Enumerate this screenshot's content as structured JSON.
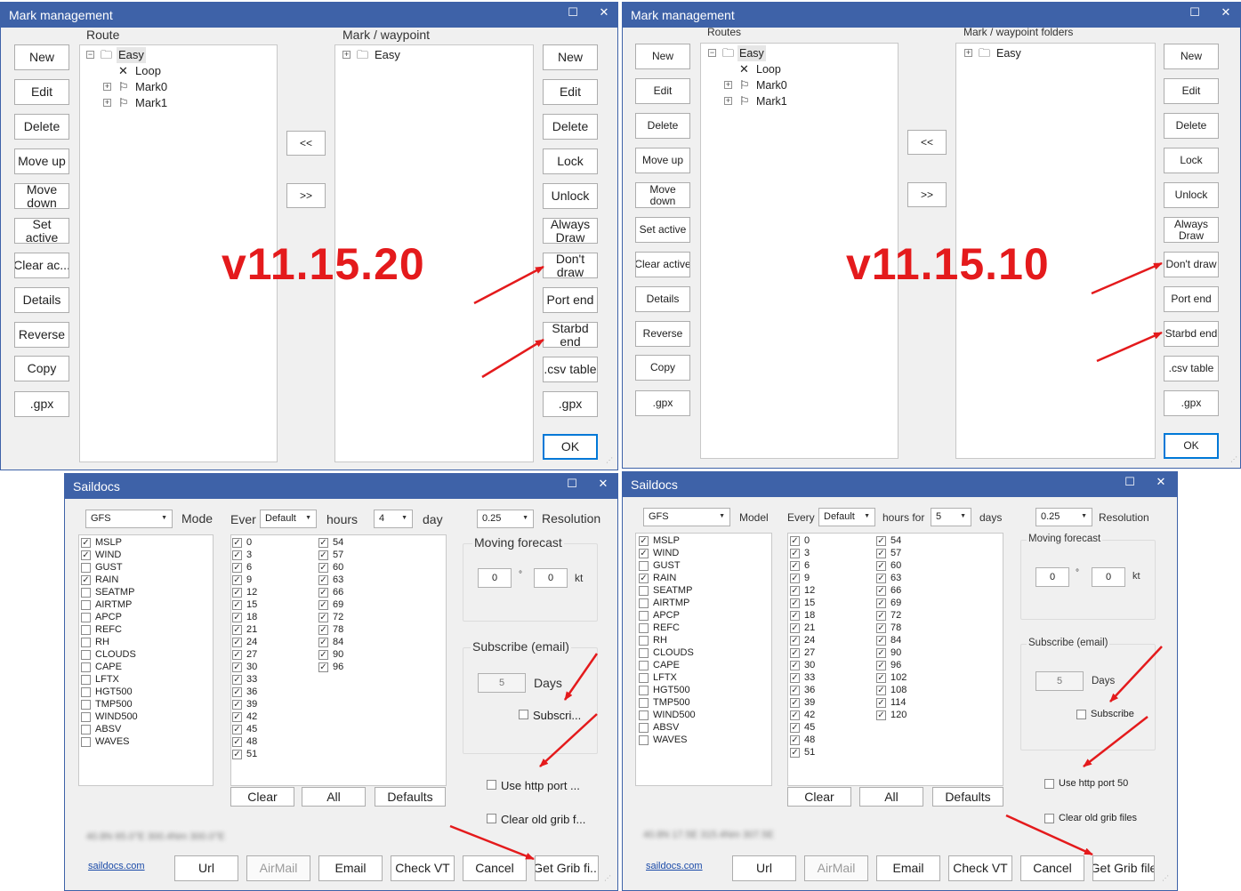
{
  "v1": {
    "title": "Mark management",
    "route_label": "Route",
    "mark_label": "Mark / waypoint",
    "left_buttons": [
      "New",
      "Edit",
      "Delete",
      "Move up",
      "Move down",
      "Set active",
      "Clear ac...",
      "Details",
      "Reverse",
      "Copy",
      ".gpx"
    ],
    "right_buttons": [
      "New",
      "Edit",
      "Delete",
      "Lock",
      "Unlock",
      "Always Draw",
      "Don't draw",
      "Port end",
      "Starbd end",
      ".csv table",
      ".gpx",
      "OK"
    ],
    "move_left": "<<",
    "move_right": ">>",
    "route_tree": [
      "Easy",
      "Loop",
      "Mark0",
      "Mark1"
    ],
    "mark_tree": [
      "Easy"
    ],
    "version": "v11.15.20"
  },
  "v2": {
    "title": "Mark management",
    "route_label": "Routes",
    "mark_label": "Mark / waypoint folders",
    "left_buttons": [
      "New",
      "Edit",
      "Delete",
      "Move up",
      "Move down",
      "Set active",
      "Clear active",
      "Details",
      "Reverse",
      "Copy",
      ".gpx"
    ],
    "right_buttons": [
      "New",
      "Edit",
      "Delete",
      "Lock",
      "Unlock",
      "Always Draw",
      "Don't draw",
      "Port end",
      "Starbd end",
      ".csv table",
      ".gpx",
      "OK"
    ],
    "move_left": "<<",
    "move_right": ">>",
    "route_tree": [
      "Easy",
      "Loop",
      "Mark0",
      "Mark1"
    ],
    "mark_tree": [
      "Easy"
    ],
    "version": "v11.15.10"
  },
  "s1": {
    "title": "Saildocs",
    "model_value": "GFS",
    "model_label": "Mode",
    "every_label": "Ever",
    "every_value": "Default",
    "hours_label": "hours",
    "days_value": "4",
    "days_label": "day",
    "res_value": "0.25",
    "res_label": "Resolution",
    "params": [
      {
        "n": "MSLP",
        "c": true
      },
      {
        "n": "WIND",
        "c": true
      },
      {
        "n": "GUST",
        "c": false
      },
      {
        "n": "RAIN",
        "c": true
      },
      {
        "n": "SEATMP",
        "c": false
      },
      {
        "n": "AIRTMP",
        "c": false
      },
      {
        "n": "APCP",
        "c": false
      },
      {
        "n": "REFC",
        "c": false
      },
      {
        "n": "RH",
        "c": false
      },
      {
        "n": "CLOUDS",
        "c": false
      },
      {
        "n": "CAPE",
        "c": false
      },
      {
        "n": "LFTX",
        "c": false
      },
      {
        "n": "HGT500",
        "c": false
      },
      {
        "n": "TMP500",
        "c": false
      },
      {
        "n": "WIND500",
        "c": false
      },
      {
        "n": "ABSV",
        "c": false
      },
      {
        "n": "WAVES",
        "c": false
      }
    ],
    "hours_col1": [
      "0",
      "3",
      "6",
      "9",
      "12",
      "15",
      "18",
      "21",
      "24",
      "27",
      "30",
      "33",
      "36",
      "39",
      "42",
      "45",
      "48",
      "51"
    ],
    "hours_col2": [
      "54",
      "57",
      "60",
      "63",
      "66",
      "69",
      "72",
      "78",
      "84",
      "90",
      "96"
    ],
    "moving_label": "Moving forecast",
    "mv1": "0",
    "deg": "°",
    "mv2": "0",
    "kt": "kt",
    "subscribe_label": "Subscribe (email)",
    "sub_days": "5",
    "days_text": "Days",
    "subscribe_cb": "Subscri...",
    "http_cb": "Use http port ...",
    "clear_cb": "Clear old grib f...",
    "list_buttons": [
      "Clear",
      "All",
      "Defaults"
    ],
    "link": "saildocs.com",
    "bottom_buttons": [
      "Url",
      "AirMail",
      "Email",
      "Check VT",
      "Cancel",
      "Get Grib fi..."
    ],
    "blurred": "40.8N 65.0°E 300.4Nm 300.0°E"
  },
  "s2": {
    "title": "Saildocs",
    "model_value": "GFS",
    "model_label": "Model",
    "every_label": "Every",
    "every_value": "Default",
    "hours_label": "hours for",
    "days_value": "5",
    "days_label": "days",
    "res_value": "0.25",
    "res_label": "Resolution",
    "params": [
      {
        "n": "MSLP",
        "c": true
      },
      {
        "n": "WIND",
        "c": true
      },
      {
        "n": "GUST",
        "c": false
      },
      {
        "n": "RAIN",
        "c": true
      },
      {
        "n": "SEATMP",
        "c": false
      },
      {
        "n": "AIRTMP",
        "c": false
      },
      {
        "n": "APCP",
        "c": false
      },
      {
        "n": "REFC",
        "c": false
      },
      {
        "n": "RH",
        "c": false
      },
      {
        "n": "CLOUDS",
        "c": false
      },
      {
        "n": "CAPE",
        "c": false
      },
      {
        "n": "LFTX",
        "c": false
      },
      {
        "n": "HGT500",
        "c": false
      },
      {
        "n": "TMP500",
        "c": false
      },
      {
        "n": "WIND500",
        "c": false
      },
      {
        "n": "ABSV",
        "c": false
      },
      {
        "n": "WAVES",
        "c": false
      }
    ],
    "hours_col1": [
      "0",
      "3",
      "6",
      "9",
      "12",
      "15",
      "18",
      "21",
      "24",
      "27",
      "30",
      "33",
      "36",
      "39",
      "42",
      "45",
      "48",
      "51"
    ],
    "hours_col2": [
      "54",
      "57",
      "60",
      "63",
      "66",
      "69",
      "72",
      "78",
      "84",
      "90",
      "96",
      "102",
      "108",
      "114",
      "120"
    ],
    "moving_label": "Moving forecast",
    "mv1": "0",
    "deg": "°",
    "mv2": "0",
    "kt": "kt",
    "subscribe_label": "Subscribe (email)",
    "sub_days": "5",
    "days_text": "Days",
    "subscribe_cb": "Subscribe",
    "http_cb": "Use http port 50",
    "clear_cb": "Clear old grib files",
    "list_buttons": [
      "Clear",
      "All",
      "Defaults"
    ],
    "link": "saildocs.com",
    "bottom_buttons": [
      "Url",
      "AirMail",
      "Email",
      "Check VT",
      "Cancel",
      "Get Grib file"
    ],
    "blurred": "40.8N 17.5E 315.4Nm 307.5E"
  },
  "window_controls": {
    "maximize": "☐",
    "close": "✕"
  },
  "annotation_color": "#e41a1c"
}
